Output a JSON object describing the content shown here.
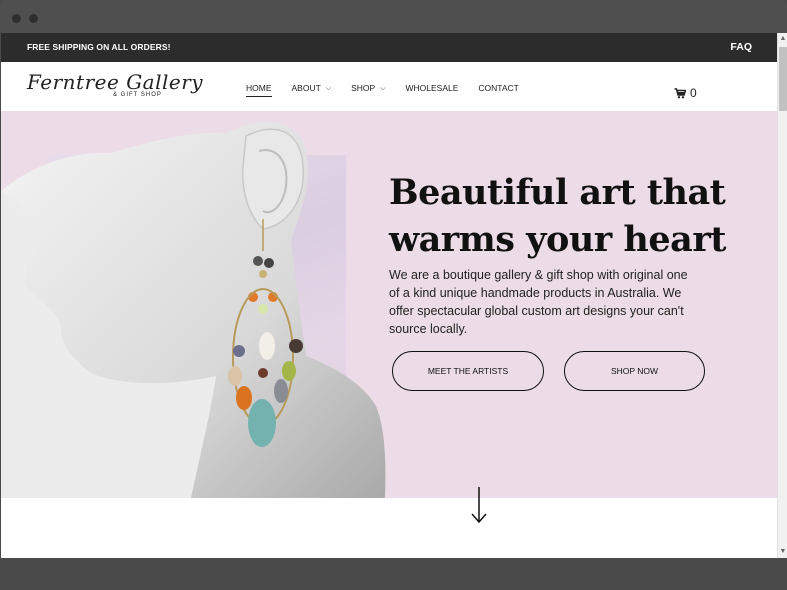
{
  "announcement": {
    "promo": "FREE SHIPPING ON ALL ORDERS!",
    "faq": "FAQ"
  },
  "logo": {
    "main": "Ferntree Gallery",
    "sub": "& GIFT SHOP"
  },
  "nav": {
    "items": [
      {
        "label": "HOME",
        "active": true,
        "dropdown": false
      },
      {
        "label": "ABOUT",
        "active": false,
        "dropdown": true
      },
      {
        "label": "SHOP",
        "active": false,
        "dropdown": true
      },
      {
        "label": "WHOLESALE",
        "active": false,
        "dropdown": false
      },
      {
        "label": "CONTACT",
        "active": false,
        "dropdown": false
      }
    ]
  },
  "cart": {
    "icon": "cart-icon",
    "count": "0"
  },
  "hero": {
    "title_line1": "Beautiful art that",
    "title_line2": "warms your heart",
    "text": "We are a boutique gallery & gift shop with original one of a kind unique handmade products in Australia. We offer spectacular global custom art designs your can't source locally.",
    "buttons": {
      "meet": "MEET THE ARTISTS",
      "shop": "SHOP NOW"
    }
  },
  "colors": {
    "hero_bg": "#ecdce7",
    "topbar_bg": "#2c2c2c",
    "text": "#111111"
  }
}
